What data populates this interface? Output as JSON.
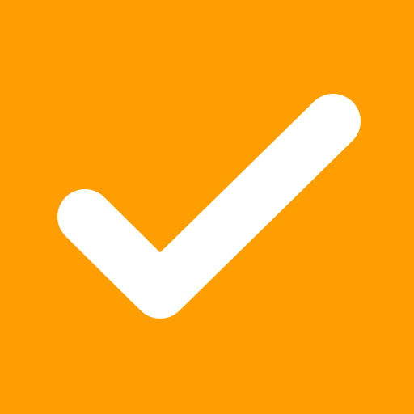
{
  "app_icon": {
    "icon": "checkmark-icon",
    "background_color": "#FF9E00",
    "glyph_color": "#FFFFFF"
  }
}
